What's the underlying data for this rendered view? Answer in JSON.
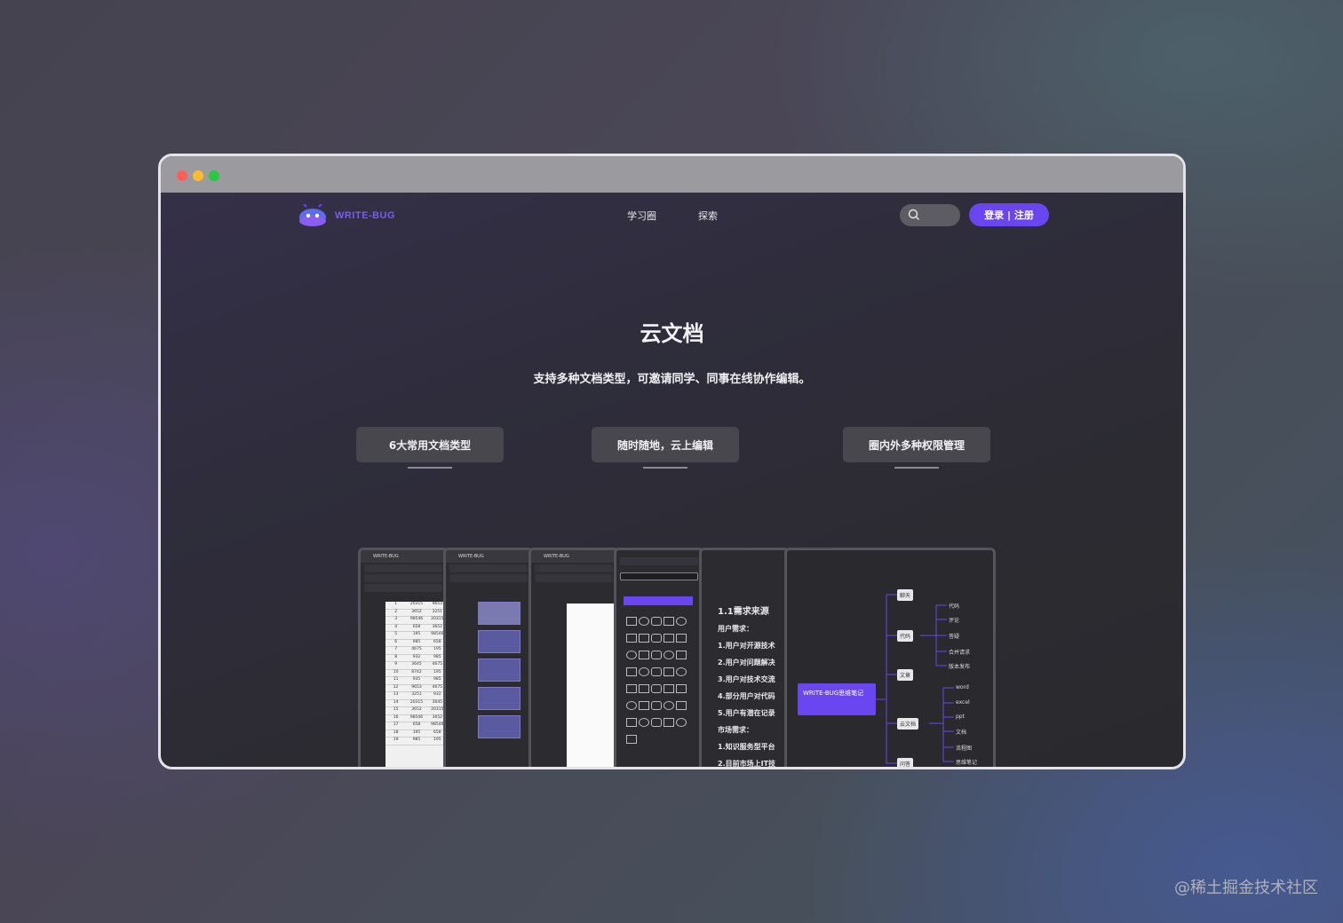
{
  "brand": {
    "name": "WRITE-BUG",
    "accent": "#6a46f0"
  },
  "nav": {
    "links": [
      "学习圈",
      "探索"
    ],
    "login_label": "登录 | 注册"
  },
  "hero": {
    "title": "云文档",
    "subtitle": "支持多种文档类型，可邀请同学、同事在线协作编辑。"
  },
  "features": [
    "6大常用文档类型",
    "随时随地，云上编辑",
    "圈内外多种权限管理"
  ],
  "previews": {
    "sheet_rows": [
      [
        "1",
        "20315",
        "9653"
      ],
      [
        "2",
        "3652",
        "3251"
      ],
      [
        "3",
        "98546",
        "20315"
      ],
      [
        "4",
        "658",
        "3652"
      ],
      [
        "5",
        "195",
        "98546"
      ],
      [
        "6",
        "985",
        "658"
      ],
      [
        "7",
        "4675",
        "195"
      ],
      [
        "8",
        "932",
        "985"
      ],
      [
        "9",
        "3645",
        "4675"
      ],
      [
        "10",
        "8742",
        "195"
      ],
      [
        "11",
        "935",
        "985"
      ],
      [
        "12",
        "9653",
        "4675"
      ],
      [
        "13",
        "3251",
        "932"
      ],
      [
        "14",
        "20315",
        "3645"
      ],
      [
        "15",
        "3652",
        "20315"
      ],
      [
        "16",
        "98546",
        "3652"
      ],
      [
        "17",
        "658",
        "98546"
      ],
      [
        "18",
        "195",
        "658"
      ],
      [
        "19",
        "985",
        "195"
      ]
    ],
    "markdown": {
      "heading": "1.1需求来源",
      "lines": [
        "用户需求：",
        "1.用户对开源技术",
        "2.用户对问题解决",
        "3.用户对技术交流",
        "4.部分用户对代码",
        "5.用户有潜在记录",
        "市场需求：",
        "1.知识服务型平台",
        "2.目前市场上IT技"
      ]
    },
    "mindmap": {
      "root": "WRITE-BUG思维笔记",
      "branches": [
        "聊天",
        "代码",
        "文章",
        "云文档",
        "问答"
      ],
      "leaves_code": [
        "代码",
        "评论",
        "答疑",
        "合并请求",
        "版本发布"
      ],
      "leaves_doc": [
        "word",
        "excel",
        "ppt",
        "文档",
        "流程图",
        "思维笔记"
      ]
    }
  },
  "watermark": "@稀土掘金技术社区"
}
